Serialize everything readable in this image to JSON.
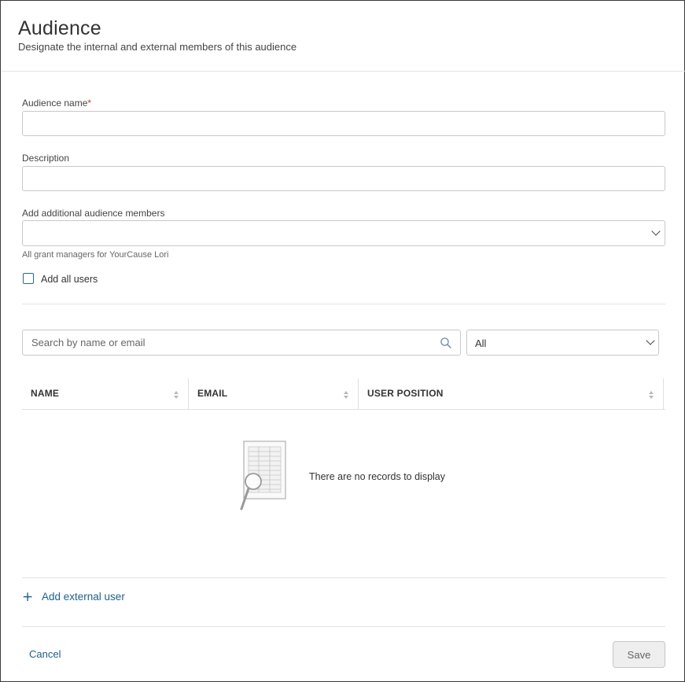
{
  "header": {
    "title": "Audience",
    "subtitle": "Designate the internal and external members of this audience"
  },
  "form": {
    "audience_name": {
      "label": "Audience name",
      "required_mark": "*",
      "value": ""
    },
    "description": {
      "label": "Description",
      "value": ""
    },
    "additional_members": {
      "label": "Add additional audience members",
      "selected": "",
      "help": "All grant managers for YourCause Lori"
    },
    "add_all_users": {
      "label": "Add all users",
      "checked": false
    }
  },
  "search": {
    "placeholder": "Search by name or email"
  },
  "filter": {
    "selected": "All"
  },
  "table": {
    "columns": [
      {
        "label": "NAME"
      },
      {
        "label": "EMAIL"
      },
      {
        "label": "USER POSITION"
      }
    ],
    "empty_message": "There are no records to display"
  },
  "add_external": {
    "label": "Add external user",
    "icon": "plus-icon"
  },
  "footer": {
    "cancel_label": "Cancel",
    "save_label": "Save"
  },
  "colors": {
    "accent": "#1f5f87",
    "required": "#c0392b",
    "border": "#c8c8c8"
  }
}
